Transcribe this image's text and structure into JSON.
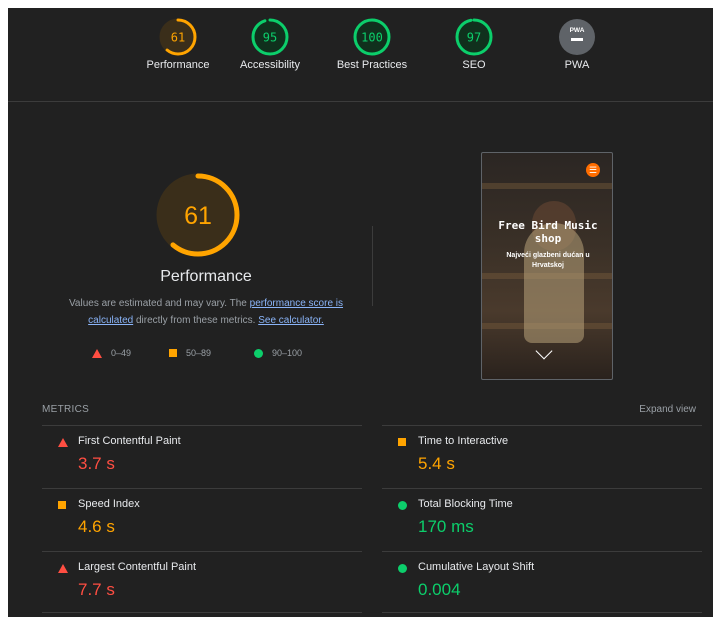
{
  "colors": {
    "fail": "#ff4e42",
    "average": "#ffa400",
    "pass": "#0cce6b",
    "pwa": "#5f6368"
  },
  "categories": [
    {
      "label": "Performance",
      "score": "61",
      "level": "average",
      "fraction": 0.61
    },
    {
      "label": "Accessibility",
      "score": "95",
      "level": "pass",
      "fraction": 0.95
    },
    {
      "label": "Best Practices",
      "score": "100",
      "level": "pass",
      "fraction": 1.0
    },
    {
      "label": "SEO",
      "score": "97",
      "level": "pass",
      "fraction": 0.97
    },
    {
      "label": "PWA",
      "badge": "PWA",
      "icon": "pwa-dash-icon"
    }
  ],
  "performance": {
    "score": "61",
    "fraction": 0.61,
    "title": "Performance",
    "note_prefix": "Values are estimated and may vary. The ",
    "note_link1": "performance score is calculated",
    "note_middle": " directly from these metrics. ",
    "note_link2": "See calculator.",
    "legend": [
      {
        "range": "0–49",
        "icon": "triangle-icon"
      },
      {
        "range": "50–89",
        "icon": "square-icon"
      },
      {
        "range": "90–100",
        "icon": "circle-icon"
      }
    ]
  },
  "screenshot": {
    "title": "Free Bird Music shop",
    "subtitle": "Najveći glazbeni dućan u Hrvatskoj",
    "menu_icon": "menu-icon",
    "scroll_icon": "chevron-down-icon"
  },
  "metrics": {
    "heading": "METRICS",
    "expand_label": "Expand view",
    "items": [
      {
        "name": "First Contentful Paint",
        "value": "3.7 s",
        "level": "fail"
      },
      {
        "name": "Time to Interactive",
        "value": "5.4 s",
        "level": "average"
      },
      {
        "name": "Speed Index",
        "value": "4.6 s",
        "level": "average"
      },
      {
        "name": "Total Blocking Time",
        "value": "170 ms",
        "level": "pass"
      },
      {
        "name": "Largest Contentful Paint",
        "value": "7.7 s",
        "level": "fail"
      },
      {
        "name": "Cumulative Layout Shift",
        "value": "0.004",
        "level": "pass"
      }
    ]
  }
}
